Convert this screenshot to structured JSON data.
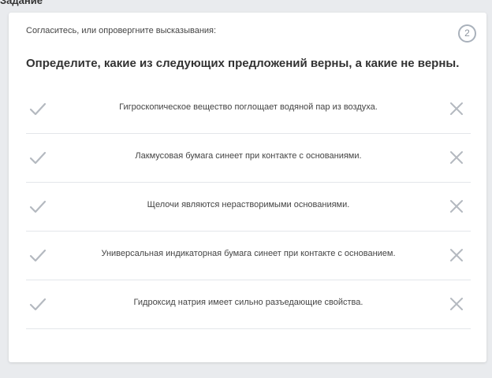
{
  "header": {
    "fragment": "Задание"
  },
  "task": {
    "instruction": "Согласитесь, или опровергните высказывания:",
    "number": "2",
    "question": "Определите, какие из следующих предложений верны, а какие не верны."
  },
  "statements": [
    {
      "text": "Гигроскопическое вещество поглощает водяной пар из воздуха."
    },
    {
      "text": "Лакмусовая бумага синеет при контакте с основаниями."
    },
    {
      "text": "Щелочи являются нерастворимыми основаниями."
    },
    {
      "text": "Универсальная индикаторная бумага синеет при контакте с основанием."
    },
    {
      "text": "Гидроксид натрия имеет сильно разъедающие свойства."
    }
  ],
  "colors": {
    "icon": "#b4b9c0",
    "divider": "#e3e6ea",
    "background": "#e9ebee"
  },
  "icons": {
    "agree": "check-icon",
    "disagree": "close-icon"
  }
}
